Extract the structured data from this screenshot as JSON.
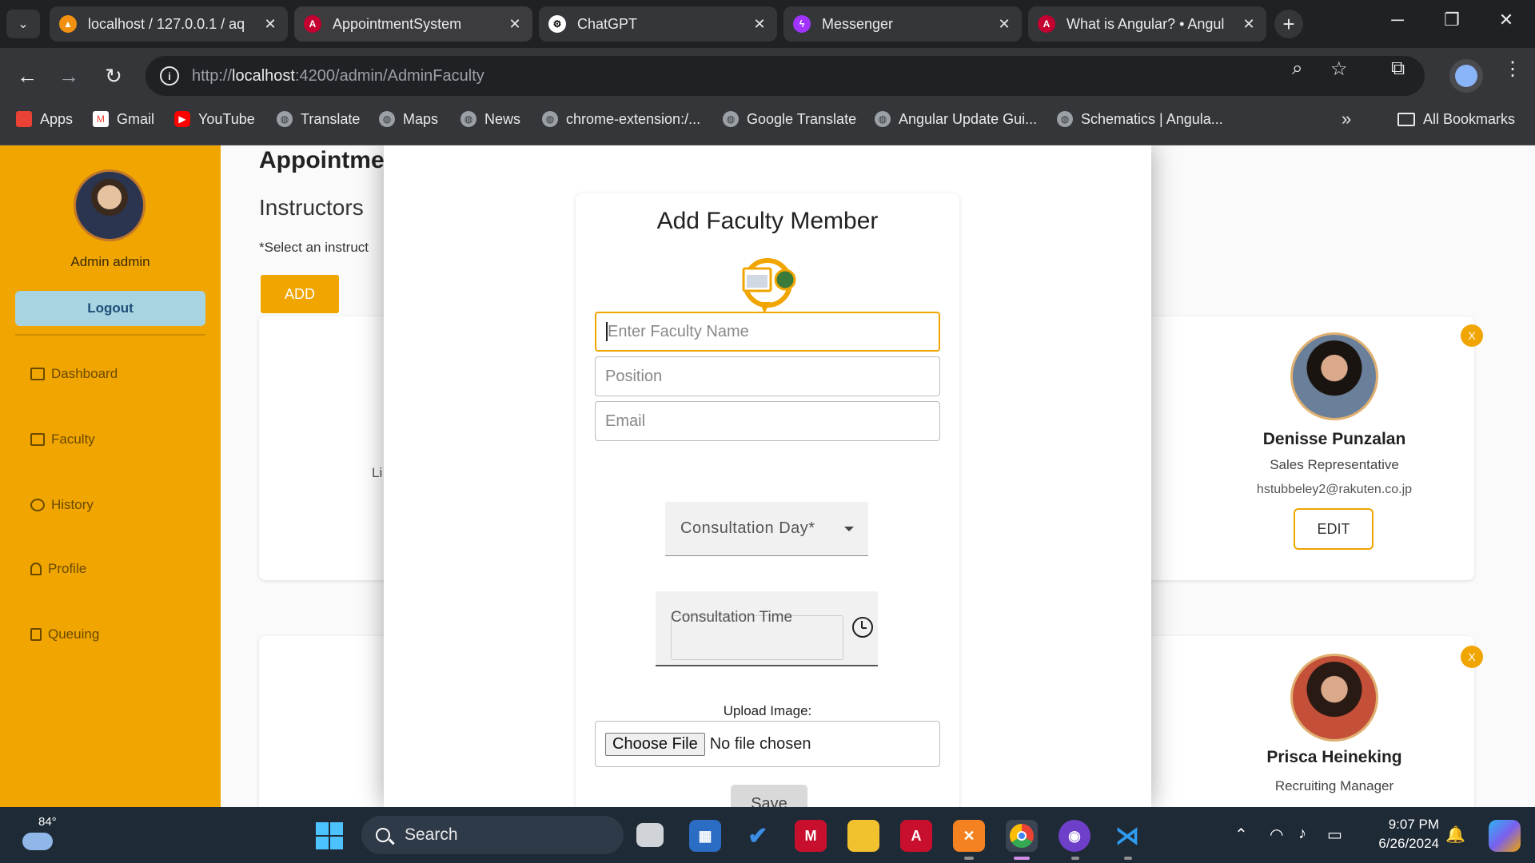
{
  "browser": {
    "tabs": [
      {
        "title": "localhost / 127.0.0.1 / aq",
        "icon": "phpmyadmin-icon"
      },
      {
        "title": "AppointmentSystem",
        "icon": "angular-icon"
      },
      {
        "title": "ChatGPT",
        "icon": "chatgpt-icon"
      },
      {
        "title": "Messenger",
        "icon": "messenger-icon"
      },
      {
        "title": "What is Angular? • Angul",
        "icon": "angular-icon"
      }
    ],
    "url_host": "localhost",
    "url_prefix": "http://",
    "url_path": ":4200/admin/AdminFaculty",
    "bookmarks": [
      {
        "label": "Apps"
      },
      {
        "label": "Gmail"
      },
      {
        "label": "YouTube"
      },
      {
        "label": "Translate"
      },
      {
        "label": "Maps"
      },
      {
        "label": "News"
      },
      {
        "label": "chrome-extension:/..."
      },
      {
        "label": "Google Translate"
      },
      {
        "label": "Angular Update Gui..."
      },
      {
        "label": "Schematics | Angula..."
      }
    ],
    "all_bookmarks": "All Bookmarks"
  },
  "sidebar": {
    "admin_name": "Admin admin",
    "logout_label": "Logout",
    "items": [
      {
        "label": "Dashboard"
      },
      {
        "label": "Faculty"
      },
      {
        "label": "History"
      },
      {
        "label": "Profile"
      },
      {
        "label": "Queuing"
      }
    ]
  },
  "main": {
    "title": "Appointme",
    "subtitle": "Instructors",
    "note": "*Select an instruct",
    "add_label": "ADD",
    "stub_text": "Li",
    "cards": [
      {
        "name": "Denisse Punzalan",
        "position": "Sales Representative",
        "email": "hstubbeley2@rakuten.co.jp",
        "edit_label": "EDIT",
        "close_label": "X"
      },
      {
        "name": "Prisca Heineking",
        "position": "Recruiting Manager",
        "close_label": "X"
      }
    ]
  },
  "modal": {
    "title": "Add Faculty Member",
    "name_placeholder": "Enter Faculty Name",
    "position_placeholder": "Position",
    "email_placeholder": "Email",
    "day_label": "Consultation Day*",
    "time_label": "Consultation Time",
    "upload_label": "Upload Image:",
    "choose_file": "Choose File",
    "no_file": "No file chosen",
    "save_label": "Save"
  },
  "taskbar": {
    "temperature": "84°",
    "search": "Search",
    "time": "9:07 PM",
    "date": "6/26/2024"
  },
  "colors": {
    "accent": "#f0a500",
    "sidebar": "#f0a500",
    "logout": "#a7d4e0"
  }
}
